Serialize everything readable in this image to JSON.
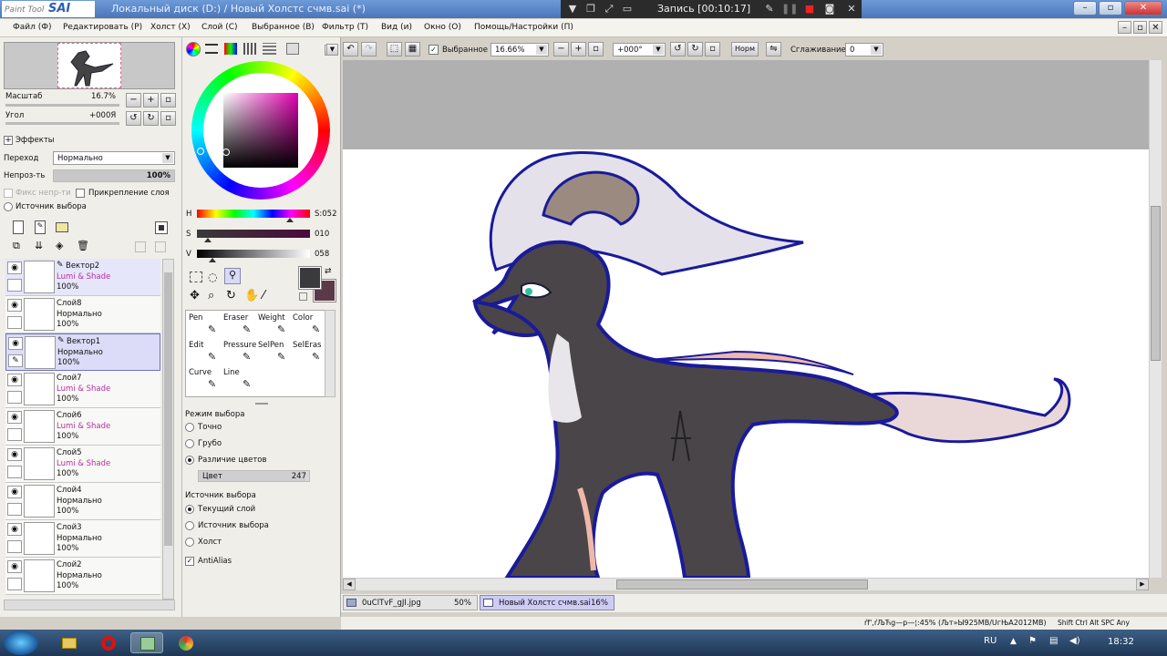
{
  "app": {
    "logo_main": "SAI",
    "logo_sub": "Paint Tool",
    "title": "Локальный диск (D:) / Новый Холстс счмв.sai (*)"
  },
  "recorder": {
    "text": "Запись [00:10:17]"
  },
  "menu": [
    "Файл (Ф)",
    "Редактировать (Р)",
    "Холст (Х)",
    "Слой (С)",
    "Выбранное (В)",
    "Фильтр (Т)",
    "Вид (и)",
    "Окно (О)",
    "Помощь/Настройки (П)"
  ],
  "navigator": {
    "zoom_label": "Масштаб",
    "zoom_value": "16.7%",
    "angle_label": "Угол",
    "angle_value": "+000Я"
  },
  "effects": {
    "title": "Эффекты",
    "blend_label": "Переход",
    "blend_value": "Нормально",
    "opacity_label": "Непроз-ть",
    "opacity_value": "100%",
    "opacity_fraction": 1.0,
    "fix_label": "Фикс непр-ти",
    "clip_label": "Прикрепление слоя",
    "source_label": "Источник выбора"
  },
  "layers": [
    {
      "name": "Вектор2",
      "mode": "Lumi & Shade",
      "opacity": "100%",
      "vector": true,
      "selected": false,
      "highlight": true
    },
    {
      "name": "Слой8",
      "mode": "Нормально",
      "opacity": "100%",
      "vector": false,
      "selected": false,
      "highlight": false
    },
    {
      "name": "Вектор1",
      "mode": "Нормально",
      "opacity": "100%",
      "vector": true,
      "selected": true,
      "highlight": false
    },
    {
      "name": "Слой7",
      "mode": "Lumi & Shade",
      "opacity": "100%",
      "vector": false,
      "selected": false,
      "highlight": false
    },
    {
      "name": "Слой6",
      "mode": "Lumi & Shade",
      "opacity": "100%",
      "vector": false,
      "selected": false,
      "highlight": false
    },
    {
      "name": "Слой5",
      "mode": "Lumi & Shade",
      "opacity": "100%",
      "vector": false,
      "selected": false,
      "highlight": false
    },
    {
      "name": "Слой4",
      "mode": "Нормально",
      "opacity": "100%",
      "vector": false,
      "selected": false,
      "highlight": false
    },
    {
      "name": "Слой3",
      "mode": "Нормально",
      "opacity": "100%",
      "vector": false,
      "selected": false,
      "highlight": false
    },
    {
      "name": "Слой2",
      "mode": "Нормально",
      "opacity": "100%",
      "vector": false,
      "selected": false,
      "highlight": false
    }
  ],
  "color": {
    "h_label": "H",
    "h_value": "S:052",
    "s_label": "S",
    "s_value": "010",
    "v_label": "V",
    "v_value": "058",
    "h_level": 0.82,
    "s_level": 0.1,
    "v_level": 0.14,
    "primary": "#3a3a3c",
    "secondary": "#5a3a48"
  },
  "tools": [
    {
      "name": "Pen",
      "icon": "pen-icon"
    },
    {
      "name": "Eraser",
      "icon": "eraser-icon"
    },
    {
      "name": "Weight",
      "icon": "weight-icon"
    },
    {
      "name": "Color",
      "icon": "color-icon"
    },
    {
      "name": "Edit",
      "icon": "edit-icon"
    },
    {
      "name": "Pressure",
      "icon": "pressure-icon"
    },
    {
      "name": "SelPen",
      "icon": "selpen-icon"
    },
    {
      "name": "SelEras",
      "icon": "seleras-icon"
    },
    {
      "name": "Curve",
      "icon": "curve-icon"
    },
    {
      "name": "Line",
      "icon": "line-icon"
    }
  ],
  "tool_options": {
    "mode_title": "Режим выбора",
    "mode_exact": "Точно",
    "mode_rough": "Грубо",
    "mode_color": "Различие цветов",
    "color_label": "Цвет",
    "color_value": "247",
    "color_level": 0.97,
    "source_title": "Источник выбора",
    "src_current": "Текущий слой",
    "src_source": "Источник выбора",
    "src_canvas": "Холст",
    "antialias": "AntiAlias"
  },
  "canvas_toolbar": {
    "selection_label": "Выбранное",
    "zoom": "16.66%",
    "angle": "+000°",
    "norm": "Норм",
    "smoothing_label": "Сглаживание",
    "smoothing_value": "0"
  },
  "documents": [
    {
      "name": "0uClTvF_gJI.jpg",
      "zoom": "50%"
    },
    {
      "name": "Новый Холстс счмв.sai",
      "zoom": "16%"
    }
  ],
  "status": {
    "memory": "ŕf',ŕЉЋg—р—¦:45% (Љт»Ы925MB/UгЊA2012MB)",
    "keys": "Shift Ctrl Alt SPC Any"
  },
  "taskbar": {
    "lang": "RU",
    "time": "18:32"
  }
}
